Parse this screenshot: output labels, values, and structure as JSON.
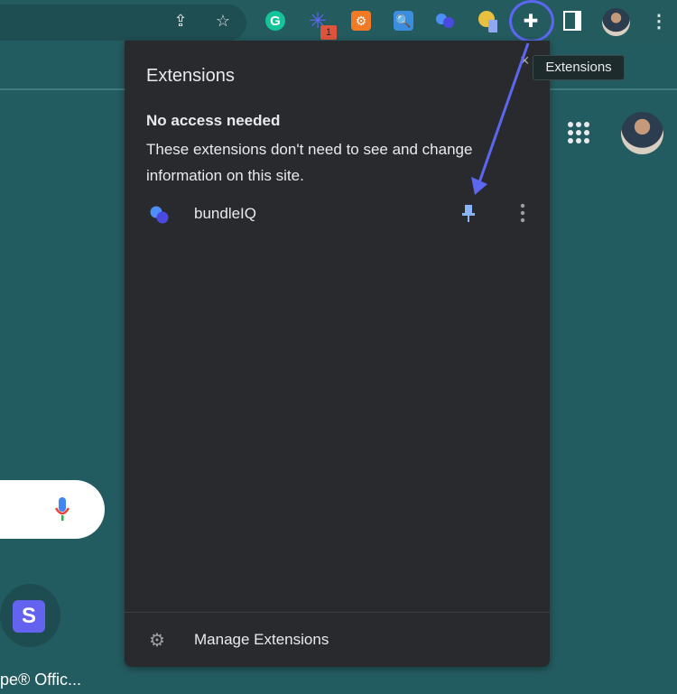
{
  "toolbar": {
    "extension_badge": "1",
    "extensions_tooltip": "Extensions"
  },
  "popup": {
    "title": "Extensions",
    "close_icon": "×",
    "section_heading": "No access needed",
    "section_description": "These extensions don't need to see and change information on this site.",
    "extensions": [
      {
        "name": "bundleIQ",
        "pinned": true
      }
    ],
    "manage_label": "Manage Extensions"
  },
  "page": {
    "shortcut_letter": "S",
    "shortcut_label": "pe® Offic..."
  },
  "colors": {
    "accent": "#5b67f0",
    "pin": "#8ab4f8",
    "popup_bg": "#292a2d",
    "page_bg": "#235c60"
  }
}
